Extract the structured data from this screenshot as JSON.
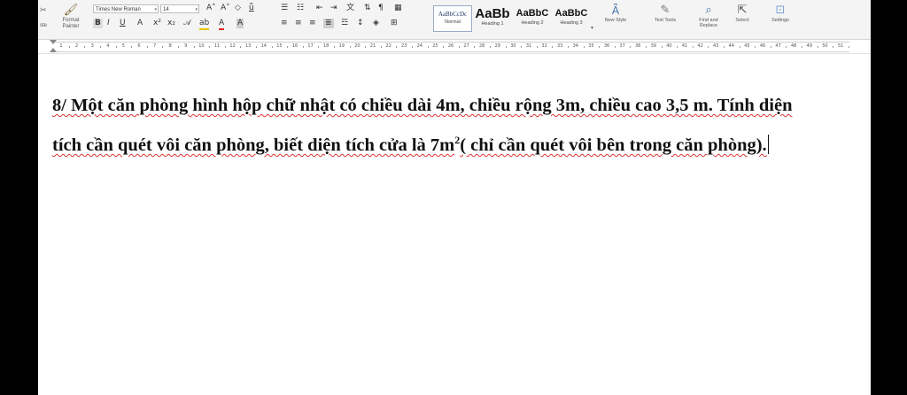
{
  "ribbon": {
    "clipboard": {
      "paste_label": "ste",
      "format_painter_label": "Format Painter"
    },
    "font": {
      "font_name": "Times New Roman",
      "font_size": "14",
      "grow_icon": "A˄",
      "shrink_icon": "A˅",
      "bold": "B",
      "italic": "I",
      "underline": "U",
      "text_effects": "A",
      "superscript": "x²",
      "subscript": "x₂",
      "highlight": "ab",
      "font_color": "A",
      "char_shading": "A"
    },
    "styles": [
      {
        "preview": "AaBbCcDc",
        "name": "Normal",
        "selected": true
      },
      {
        "preview": "AaBb",
        "name": "Heading 1"
      },
      {
        "preview": "AaBbC",
        "name": "Heading 2"
      },
      {
        "preview": "AaBbC",
        "name": "Heading 3"
      }
    ],
    "buttons": {
      "new_style": "New Style",
      "text_tools": "Text Tools",
      "find_replace": "Find and Replace",
      "select": "Select",
      "settings": "Settings"
    }
  },
  "ruler": {
    "numbers": [
      "1",
      "2",
      "3",
      "4",
      "5",
      "6",
      "7",
      "8",
      "9",
      "10",
      "11",
      "12",
      "13",
      "14",
      "15",
      "16",
      "17",
      "18",
      "19",
      "20",
      "21",
      "22",
      "23",
      "24",
      "25",
      "26",
      "27",
      "28",
      "29",
      "30",
      "31",
      "32",
      "33",
      "34",
      "35",
      "36",
      "37",
      "38",
      "39",
      "40",
      "41",
      "42",
      "43",
      "44",
      "45",
      "46",
      "47",
      "48",
      "49",
      "50",
      "51"
    ]
  },
  "document": {
    "line1": "8/ Một căn phòng hình hộp chữ nhật có chiều dài 4m, chiều rộng 3m, chiều cao 3,5 m. Tính diện",
    "line2_before": "tích cần quét vôi căn phòng, biết diện tích cửa là 7m",
    "line2_sup": "2",
    "line2_after": "( chỉ cần quét vôi bên trong căn phòng)."
  }
}
